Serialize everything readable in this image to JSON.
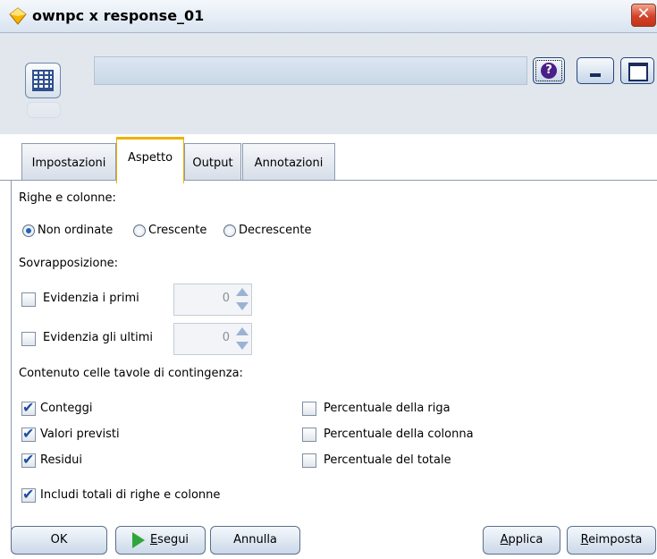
{
  "window": {
    "title": "ownpc x response_01",
    "close_glyph": "✕",
    "help_glyph": "?"
  },
  "tabs": [
    {
      "label": "Impostazioni",
      "active": false
    },
    {
      "label": "Aspetto",
      "active": true
    },
    {
      "label": "Output",
      "active": false
    },
    {
      "label": "Annotazioni",
      "active": false
    }
  ],
  "rows_columns": {
    "heading": "Righe e colonne:",
    "options": [
      "Non ordinate",
      "Crescente",
      "Decrescente"
    ],
    "selected": "Non ordinate"
  },
  "overlap": {
    "heading": "Sovrapposizione:",
    "highlight_top": {
      "label": "Evidenzia i primi",
      "checked": false,
      "value": "0"
    },
    "highlight_bottom": {
      "label": "Evidenzia gli ultimi",
      "checked": false,
      "value": "0"
    }
  },
  "cell_contents": {
    "heading": "Contenuto celle tavole di contingenza:",
    "left": [
      {
        "label": "Conteggi",
        "checked": true
      },
      {
        "label": "Valori previsti",
        "checked": true
      },
      {
        "label": "Residui",
        "checked": true
      }
    ],
    "right": [
      {
        "label": "Percentuale della riga",
        "checked": false
      },
      {
        "label": "Percentuale della colonna",
        "checked": false
      },
      {
        "label": "Percentuale del totale",
        "checked": false
      }
    ],
    "include_totals": {
      "label": "Includi totali di righe e colonne",
      "checked": true
    }
  },
  "buttons": {
    "ok": "OK",
    "run_first": "E",
    "run_rest": "segui",
    "cancel": "Annulla",
    "apply_first": "A",
    "apply_rest": "pplica",
    "reset_first": "R",
    "reset_rest": "eimposta"
  },
  "colors": {
    "active_tab_accent": "#f0b000",
    "run_icon": "#2ea63a",
    "close_button": "#d2432a"
  },
  "icons": [
    "node-icon",
    "help-icon",
    "minimize-icon",
    "maximize-icon",
    "close-icon",
    "run-icon"
  ]
}
